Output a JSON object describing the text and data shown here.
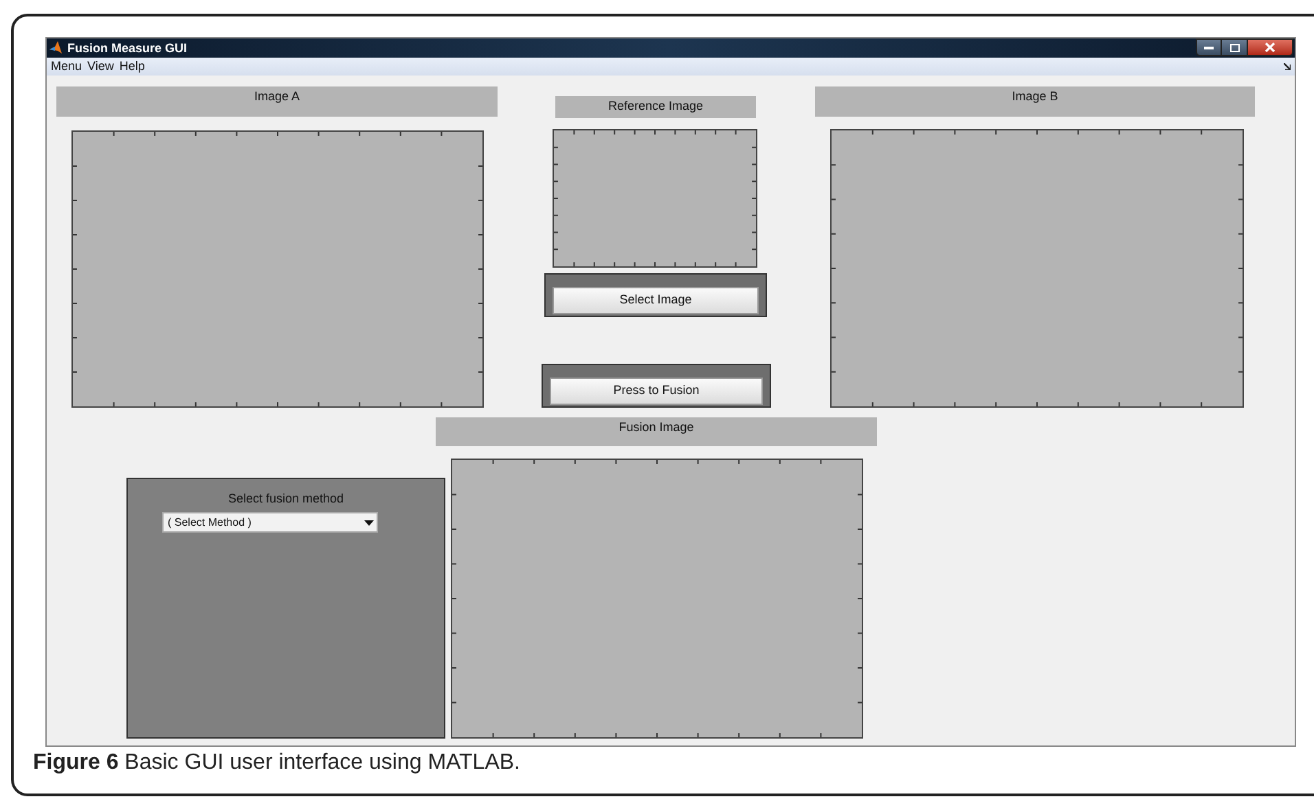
{
  "window": {
    "title": "Fusion Measure GUI"
  },
  "menu": [
    "Menu",
    "View",
    "Help"
  ],
  "image_a": {
    "label": "Image A"
  },
  "reference": {
    "label": "Reference Image"
  },
  "buttons": [
    {
      "label": "Select Image"
    },
    {
      "label": "Press to Fusion"
    }
  ],
  "image_b": {
    "label": "Image B"
  },
  "fusion": {
    "label": "Fusion Image"
  },
  "method_panel": {
    "title": "Select fusion method",
    "dropdown": {
      "value": "( Select Method )"
    }
  },
  "caption": "**Figure 6** Basic GUI user interface using MATLAB."
}
